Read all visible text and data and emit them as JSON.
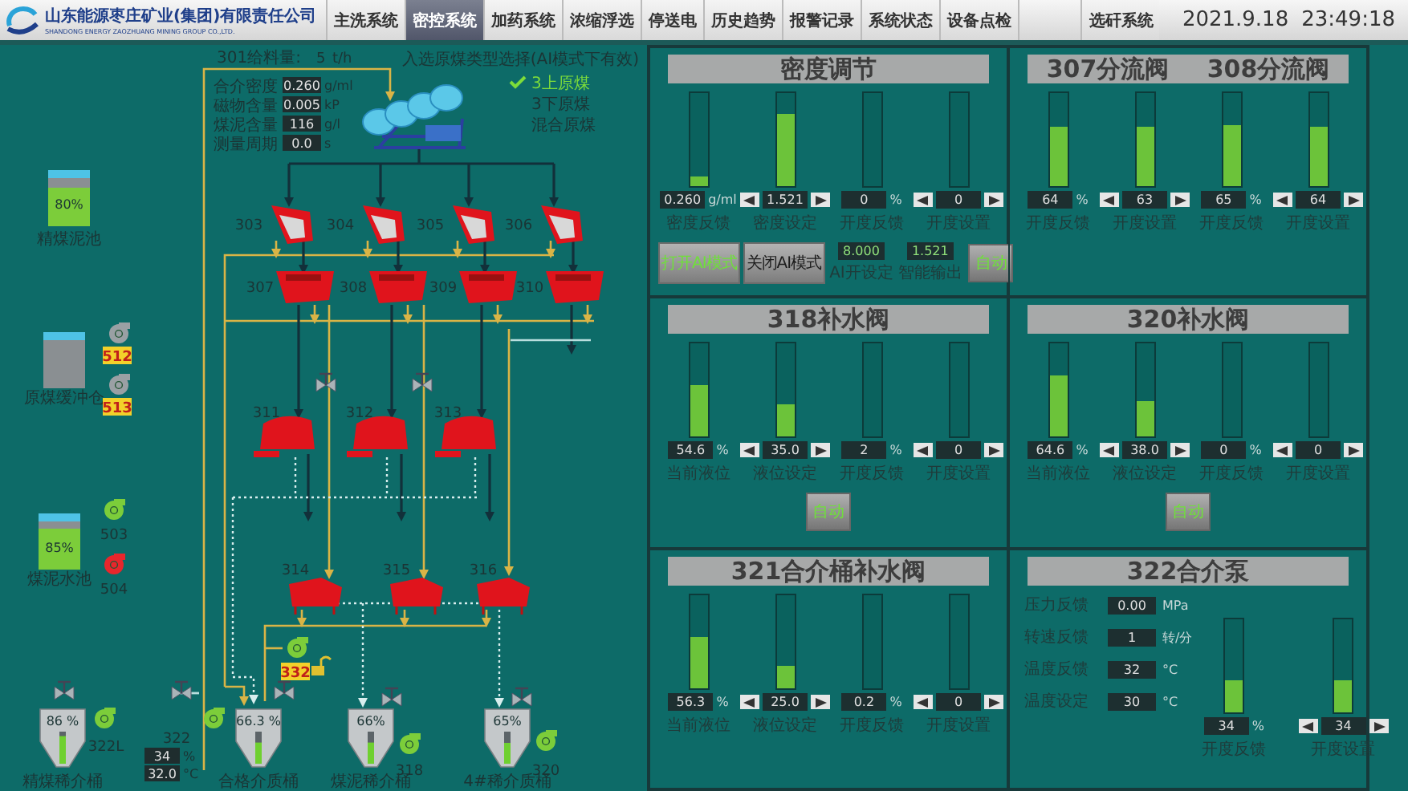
{
  "header": {
    "company": "山东能源枣庄矿业(集团)有限责任公司",
    "company_en": "SHANDONG ENERGY ZAOZHUANG MINING GROUP CO.,LTD.",
    "tabs": [
      {
        "label": "主洗系统",
        "selected": false
      },
      {
        "label": "密控系统",
        "selected": true
      },
      {
        "label": "加药系统",
        "selected": false
      },
      {
        "label": "浓缩浮选",
        "selected": false
      },
      {
        "label": "停送电",
        "selected": false
      },
      {
        "label": "历史趋势",
        "selected": false
      },
      {
        "label": "报警记录",
        "selected": false
      },
      {
        "label": "系统状态",
        "selected": false
      },
      {
        "label": "设备点检",
        "selected": false
      }
    ],
    "right_tab": {
      "label": "选矸系统",
      "selected": false
    },
    "date": "2021.9.18",
    "time": "23:49:18"
  },
  "diagram": {
    "feed": {
      "label": "301给料量:",
      "value": "5",
      "unit": "t/h"
    },
    "params": [
      {
        "label": "合介密度",
        "value": "0.260",
        "unit": "g/ml"
      },
      {
        "label": "磁物含量",
        "value": "0.005",
        "unit": "kP"
      },
      {
        "label": "煤泥含量",
        "value": "116",
        "unit": "g/l"
      },
      {
        "label": "测量周期",
        "value": "0.0",
        "unit": "s"
      }
    ],
    "coal_type": {
      "title": "入选原煤类型选择(AI模式下有效)",
      "options": [
        {
          "label": "3上原煤",
          "selected": true
        },
        {
          "label": "3下原煤",
          "selected": false
        },
        {
          "label": "混合原煤",
          "selected": false
        }
      ]
    },
    "equipment": [
      {
        "kind": "sieve_bend",
        "number": "303"
      },
      {
        "kind": "sieve_bend",
        "number": "304"
      },
      {
        "kind": "sieve_bend",
        "number": "305"
      },
      {
        "kind": "sieve_bend",
        "number": "306"
      },
      {
        "kind": "screen",
        "number": "307"
      },
      {
        "kind": "screen",
        "number": "308"
      },
      {
        "kind": "screen",
        "number": "309"
      },
      {
        "kind": "screen",
        "number": "310"
      },
      {
        "kind": "magnetic_separator",
        "number": "311"
      },
      {
        "kind": "magnetic_separator",
        "number": "312"
      },
      {
        "kind": "magnetic_separator",
        "number": "313"
      },
      {
        "kind": "separator",
        "number": "314"
      },
      {
        "kind": "separator",
        "number": "315"
      },
      {
        "kind": "separator",
        "number": "316"
      }
    ],
    "bins": [
      {
        "value": "80%",
        "label": "精煤泥池",
        "level": 0.8
      },
      {
        "label": "原煤缓冲仓"
      },
      {
        "value": "85%",
        "label": "煤泥水池",
        "level": 0.85
      }
    ],
    "pumps": [
      {
        "number": "512",
        "color": "#9aa0a4",
        "badge": true
      },
      {
        "number": "513",
        "color": "#9aa0a4",
        "badge": true
      },
      {
        "number": "503",
        "color": "#7ccd3a",
        "badge": false
      },
      {
        "number": "504",
        "color": "#e8262c",
        "badge": false
      },
      {
        "number": "332",
        "color": "#7ccd3a",
        "badge": true
      },
      {
        "number": "322L",
        "color": "#7ccd3a",
        "badge": false
      },
      {
        "number": "322",
        "color": "#7ccd3a",
        "badge": false
      },
      {
        "number": "318",
        "color": "#7ccd3a",
        "badge": false
      },
      {
        "number": "320",
        "color": "#7ccd3a",
        "badge": false
      }
    ],
    "cones": [
      {
        "value": "86 %",
        "label": "精煤稀介桶",
        "level": 0.86
      },
      {
        "value": "66.3 %",
        "label": "合格介质桶",
        "level": 0.66
      },
      {
        "value": "66%",
        "label": "煤泥稀介桶",
        "level": 0.66
      },
      {
        "value": "65%",
        "label": "4#稀介质桶",
        "level": 0.65
      }
    ],
    "pump_322_readouts": [
      {
        "value": "34",
        "unit": "%"
      },
      {
        "value": "32.0",
        "unit": "°C"
      }
    ]
  },
  "panels": [
    {
      "titles": [
        "密度调节"
      ],
      "gauges": [
        {
          "kind": "readout",
          "value": "0.260",
          "unit": "g/ml",
          "label": "密度反馈",
          "level": 0.1
        },
        {
          "kind": "setpoint",
          "value": "1.521",
          "label": "密度设定",
          "level": 0.78
        },
        {
          "kind": "readout",
          "value": "0",
          "unit": "%",
          "label": "开度反馈",
          "level": 0
        },
        {
          "kind": "setpoint",
          "value": "0",
          "label": "开度设置",
          "level": 0
        }
      ],
      "ai_buttons": [
        {
          "label": "打开AI模式",
          "active": true
        },
        {
          "label": "关闭AI模式",
          "active": false
        }
      ],
      "ai_values": [
        {
          "value": "8.000",
          "label": "AI开设定"
        },
        {
          "value": "1.521",
          "label": "智能输出"
        }
      ],
      "auto_button": "自动"
    },
    {
      "titles": [
        "307分流阀",
        "308分流阀"
      ],
      "gauges": [
        {
          "kind": "readout",
          "value": "64",
          "unit": "%",
          "label": "开度反馈",
          "level": 0.64
        },
        {
          "kind": "setpoint",
          "value": "63",
          "label": "开度设置",
          "level": 0.63
        },
        {
          "kind": "readout",
          "value": "65",
          "unit": "%",
          "label": "开度反馈",
          "level": 0.65
        },
        {
          "kind": "setpoint",
          "value": "64",
          "label": "开度设置",
          "level": 0.64
        }
      ]
    },
    {
      "titles": [
        "318补水阀"
      ],
      "gauges": [
        {
          "kind": "readout",
          "value": "54.6",
          "unit": "%",
          "label": "当前液位",
          "level": 0.55
        },
        {
          "kind": "setpoint",
          "value": "35.0",
          "label": "液位设定",
          "level": 0.35
        },
        {
          "kind": "readout",
          "value": "2",
          "unit": "%",
          "label": "开度反馈",
          "level": 0
        },
        {
          "kind": "setpoint",
          "value": "0",
          "label": "开度设置",
          "level": 0
        }
      ],
      "auto_button": "自动"
    },
    {
      "titles": [
        "320补水阀"
      ],
      "gauges": [
        {
          "kind": "readout",
          "value": "64.6",
          "unit": "%",
          "label": "当前液位",
          "level": 0.65
        },
        {
          "kind": "setpoint",
          "value": "38.0",
          "label": "液位设定",
          "level": 0.38
        },
        {
          "kind": "readout",
          "value": "0",
          "unit": "%",
          "label": "开度反馈",
          "level": 0
        },
        {
          "kind": "setpoint",
          "value": "0",
          "label": "开度设置",
          "level": 0
        }
      ],
      "auto_button": "自动"
    },
    {
      "titles": [
        "321合介桶补水阀"
      ],
      "gauges": [
        {
          "kind": "readout",
          "value": "56.3",
          "unit": "%",
          "label": "当前液位",
          "level": 0.56
        },
        {
          "kind": "setpoint",
          "value": "25.0",
          "label": "液位设定",
          "level": 0.25
        },
        {
          "kind": "readout",
          "value": "0.2",
          "unit": "%",
          "label": "开度反馈",
          "level": 0
        },
        {
          "kind": "setpoint",
          "value": "0",
          "label": "开度设置",
          "level": 0
        }
      ]
    },
    {
      "titles": [
        "322合介泵"
      ],
      "params": [
        {
          "label": "压力反馈",
          "value": "0.00",
          "unit": "MPa"
        },
        {
          "label": "转速反馈",
          "value": "1",
          "unit": "转/分"
        },
        {
          "label": "温度反馈",
          "value": "32",
          "unit": "°C"
        },
        {
          "label": "温度设定",
          "value": "30",
          "unit": "°C"
        }
      ],
      "gauges": [
        {
          "kind": "readout",
          "value": "34",
          "unit": "%",
          "label": "开度反馈",
          "level": 0.34
        },
        {
          "kind": "setpoint",
          "value": "34",
          "label": "开度设置",
          "level": 0.34
        }
      ]
    }
  ]
}
